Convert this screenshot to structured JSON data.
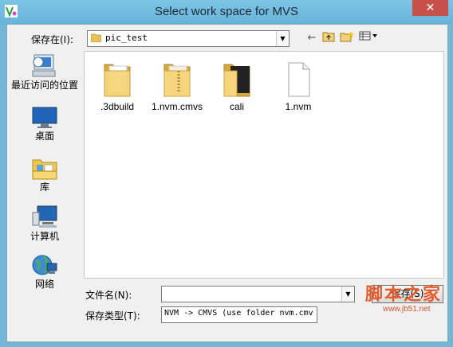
{
  "window": {
    "title": "Select work space for MVS",
    "close_glyph": "✕"
  },
  "lookin": {
    "label": "保存在(I):",
    "value": "pic_test",
    "arrow": "▼"
  },
  "toolbar": [
    {
      "name": "back-icon",
      "glyph": "←"
    },
    {
      "name": "up-folder-icon",
      "glyph": "⇡"
    },
    {
      "name": "new-folder-icon",
      "glyph": "✶"
    },
    {
      "name": "view-menu-icon",
      "glyph": "▦▾"
    }
  ],
  "places": [
    {
      "name": "recent",
      "label": "最近访问的位置"
    },
    {
      "name": "desktop",
      "label": "桌面"
    },
    {
      "name": "libraries",
      "label": "库"
    },
    {
      "name": "computer",
      "label": "计算机"
    },
    {
      "name": "network",
      "label": "网络"
    }
  ],
  "files": [
    {
      "name": ".3dbuild",
      "kind": "folder"
    },
    {
      "name": "1.nvm.cmvs",
      "kind": "folder"
    },
    {
      "name": "cali",
      "kind": "folder-dark"
    },
    {
      "name": "1.nvm",
      "kind": "file"
    }
  ],
  "filename": {
    "label": "文件名(N):",
    "value": "",
    "arrow": "▼"
  },
  "filetype": {
    "label": "保存类型(T):",
    "value": "NVM -> CMVS (use folder nvm.cmvs)"
  },
  "buttons": {
    "save": "保存(S)"
  },
  "watermark": {
    "main": "脚本之家",
    "sub": "www.jb51.net"
  },
  "colors": {
    "titlebar": "#6fb6d9",
    "close": "#c7504b",
    "watermark": "#e35a2b"
  }
}
